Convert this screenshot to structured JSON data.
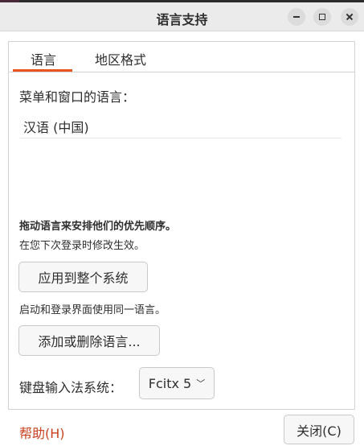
{
  "window": {
    "title": "语言支持"
  },
  "tabs": [
    {
      "label": "语言",
      "active": true
    },
    {
      "label": "地区格式",
      "active": false
    }
  ],
  "language_tab": {
    "menu_language_label": "菜单和窗口的语言：",
    "languages": [
      "汉语 (中国)"
    ],
    "drag_hint": "拖动语言来安排他们的优先顺序。",
    "effect_hint": "在您下次登录时修改生效。",
    "apply_button": "应用到整个系统",
    "login_hint": "启动和登录界面使用同一语言。",
    "add_remove_button": "添加或删除语言...",
    "input_method_label": "键盘输入法系统：",
    "input_method_value": "Fcitx 5"
  },
  "footer": {
    "help_label": "帮助(H)",
    "close_label": "关闭(C)"
  },
  "colors": {
    "accent": "#e95420",
    "help_link": "#c7411f"
  },
  "icons": {
    "minimize": "minimize-icon",
    "maximize": "maximize-icon",
    "close": "close-icon",
    "dropdown": "chevron-down-icon"
  }
}
